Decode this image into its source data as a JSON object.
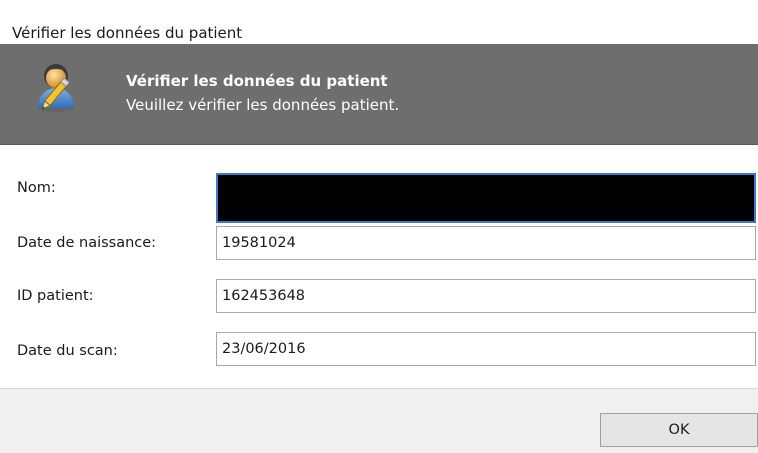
{
  "window": {
    "title": "Vérifier les données du patient"
  },
  "banner": {
    "icon": "user-edit-icon",
    "title": "Vérifier les données du patient",
    "subtitle": "Veuillez vérifier les données patient."
  },
  "form": {
    "fields": [
      {
        "label": "Nom:",
        "value": ""
      },
      {
        "label": "Date de naissance:",
        "value": "19581024"
      },
      {
        "label": "ID patient:",
        "value": "162453648"
      },
      {
        "label": "Date du scan:",
        "value": "23/06/2016"
      }
    ]
  },
  "footer": {
    "ok_label": "OK"
  },
  "colors": {
    "banner_bg": "#6e6e6e",
    "focus_border": "#3c79c8",
    "footer_bg": "#f0f0f0"
  }
}
